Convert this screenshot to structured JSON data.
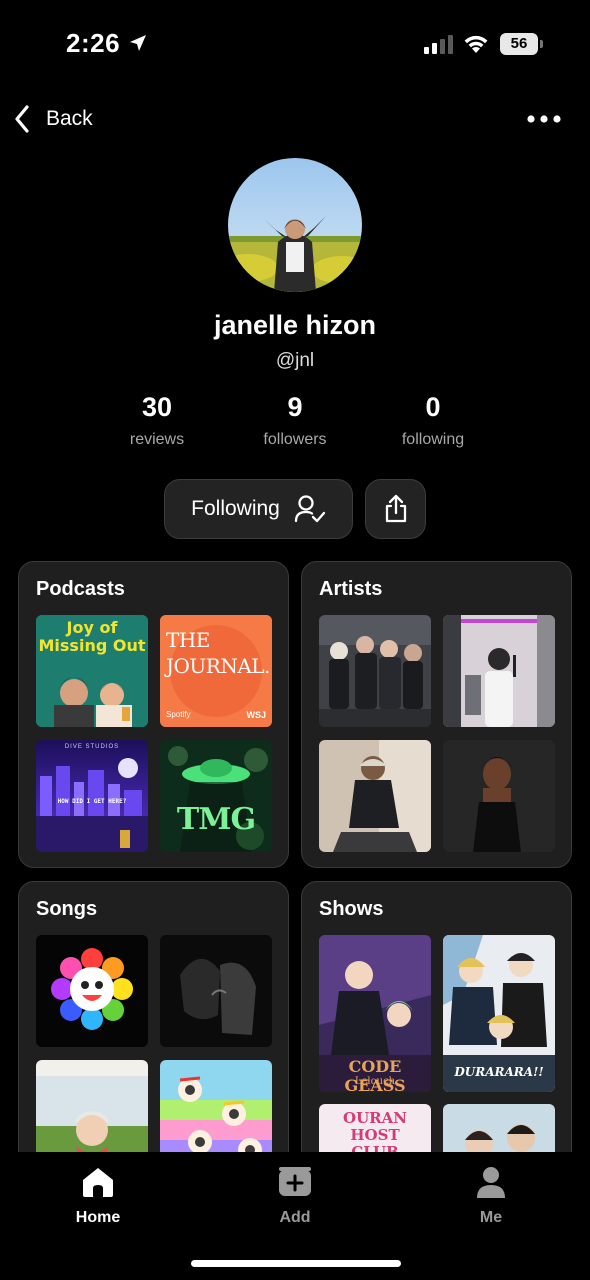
{
  "status_bar": {
    "time": "2:26",
    "battery": "56"
  },
  "nav": {
    "back_label": "Back"
  },
  "profile": {
    "name": "janelle hizon",
    "handle": "@jnl",
    "stats": [
      {
        "value": "30",
        "label": "reviews"
      },
      {
        "value": "9",
        "label": "followers"
      },
      {
        "value": "0",
        "label": "following"
      }
    ]
  },
  "actions": {
    "following_label": "Following"
  },
  "sections": {
    "podcasts": {
      "title": "Podcasts",
      "thumb_texts": {
        "joy": "Joy of Missing Out",
        "journal": "THE JOURNAL.",
        "journal_spotify": "Spotify",
        "journal_wsj": "WSJ",
        "hdigh_studio": "DIVE STUDIOS",
        "hdigh": "HOW DID I GET HERE?",
        "tmg": "TMG"
      }
    },
    "artists": {
      "title": "Artists"
    },
    "songs": {
      "title": "Songs"
    },
    "shows": {
      "title": "Shows",
      "thumb_texts": {
        "code_geass": "CODE GEASS",
        "code_geass_sub": "Lelouch",
        "durarara": "DURARARA!!",
        "ouran": "OURAN HOST CLUB"
      }
    }
  },
  "tabs": [
    {
      "label": "Home",
      "icon": "home-icon",
      "active": true
    },
    {
      "label": "Add",
      "icon": "add-icon",
      "active": false
    },
    {
      "label": "Me",
      "icon": "person-icon",
      "active": false
    }
  ],
  "colors": {
    "background": "#000000",
    "card": "#1f1f1f",
    "card_border": "#3a3a3a",
    "muted_text": "#a8a8a8",
    "inactive_tab": "#9a9a9a"
  }
}
